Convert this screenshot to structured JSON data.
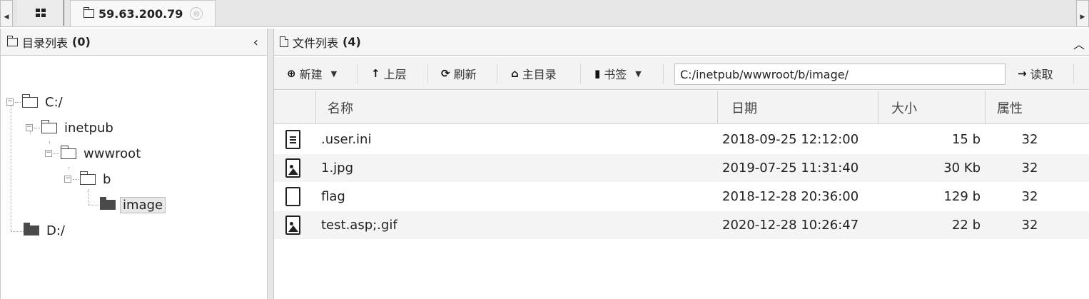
{
  "tabbar": {
    "scroll_left": "◀",
    "scroll_right": "▶",
    "active_tab": "59.63.200.79",
    "close": "⊗"
  },
  "directory_panel": {
    "title": "目录列表",
    "count": "(0)",
    "collapse": "‹"
  },
  "tree": [
    {
      "label": "C:/",
      "depth": 0,
      "expanded": true
    },
    {
      "label": "inetpub",
      "depth": 1,
      "expanded": true
    },
    {
      "label": "wwwroot",
      "depth": 2,
      "expanded": true
    },
    {
      "label": "b",
      "depth": 3,
      "expanded": true
    },
    {
      "label": "image",
      "depth": 4,
      "selected": true
    },
    {
      "label": "D:/",
      "depth": 0
    }
  ],
  "file_panel": {
    "title": "文件列表",
    "count": "(4)",
    "collapse": "︿"
  },
  "toolbar": {
    "new_label": "新建",
    "up_label": "上层",
    "refresh_label": "刷新",
    "home_label": "主目录",
    "bookmark_label": "书签",
    "path_value": "C:/inetpub/wwwroot/b/image/",
    "read_label": "读取"
  },
  "columns": {
    "name": "名称",
    "date": "日期",
    "size": "大小",
    "attr": "属性"
  },
  "files": [
    {
      "icon": "text-file-icon",
      "name": ".user.ini",
      "date": "2018-09-25 12:12:00",
      "size": "15 b",
      "attr": "32"
    },
    {
      "icon": "image-file-icon",
      "name": "1.jpg",
      "date": "2019-07-25 11:31:40",
      "size": "30 Kb",
      "attr": "32"
    },
    {
      "icon": "blank-file-icon",
      "name": "flag",
      "date": "2018-12-28 20:36:00",
      "size": "129 b",
      "attr": "32"
    },
    {
      "icon": "image-file-icon",
      "name": "test.asp;.gif",
      "date": "2020-12-28 10:26:47",
      "size": "22 b",
      "attr": "32"
    }
  ]
}
